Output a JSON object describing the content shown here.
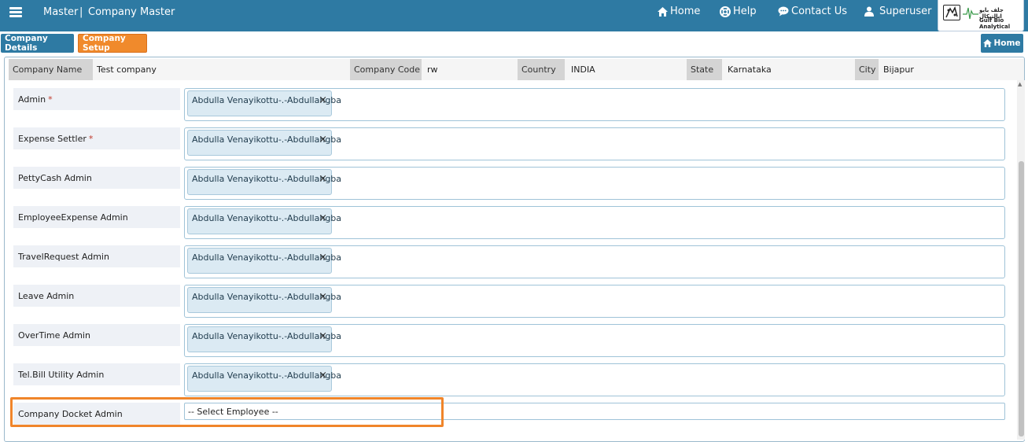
{
  "header": {
    "breadcrumb_section": "Master",
    "breadcrumb_separator": "|",
    "breadcrumb_page": "Company Master",
    "nav": {
      "home": "Home",
      "help": "Help",
      "contact": "Contact Us",
      "user": "Superuser"
    },
    "logo": {
      "arabic_text": "جلف بايو انالتيكال",
      "english_text": "Gulf Bio Analytical"
    }
  },
  "tabs": {
    "company_details": "Company Details",
    "company_setup": "Company Setup",
    "home": "Home"
  },
  "company": {
    "name_label": "Company Name",
    "name_value": "Test company",
    "code_label": "Company Code",
    "code_value": "rw",
    "country_label": "Country",
    "country_value": "INDIA",
    "state_label": "State",
    "state_value": "Karnataka",
    "city_label": "City",
    "city_value": "Bijapur"
  },
  "roles": [
    {
      "label": "Admin",
      "required": "*",
      "selected": "Abdulla Venayikottu-.-Abdullahgba"
    },
    {
      "label": "Expense Settler",
      "required": "*",
      "selected": "Abdulla Venayikottu-.-Abdullahgba"
    },
    {
      "label": "PettyCash Admin",
      "required": "",
      "selected": "Abdulla Venayikottu-.-Abdullahgba"
    },
    {
      "label": "EmployeeExpense Admin",
      "required": "",
      "selected": "Abdulla Venayikottu-.-Abdullahgba"
    },
    {
      "label": "TravelRequest Admin",
      "required": "",
      "selected": "Abdulla Venayikottu-.-Abdullahgba"
    },
    {
      "label": "Leave Admin",
      "required": "",
      "selected": "Abdulla Venayikottu-.-Abdullahgba"
    },
    {
      "label": "OverTime Admin",
      "required": "",
      "selected": "Abdulla Venayikottu-.-Abdullahgba"
    },
    {
      "label": "Tel.Bill Utility Admin",
      "required": "",
      "selected": "Abdulla Venayikottu-.-Abdullahgba"
    }
  ],
  "docket": {
    "label": "Company Docket Admin",
    "placeholder": "-- Select Employee --"
  },
  "colors": {
    "primary": "#2e7aa3",
    "accent": "#f08a2c",
    "chip_bg": "#dbeaf3"
  }
}
